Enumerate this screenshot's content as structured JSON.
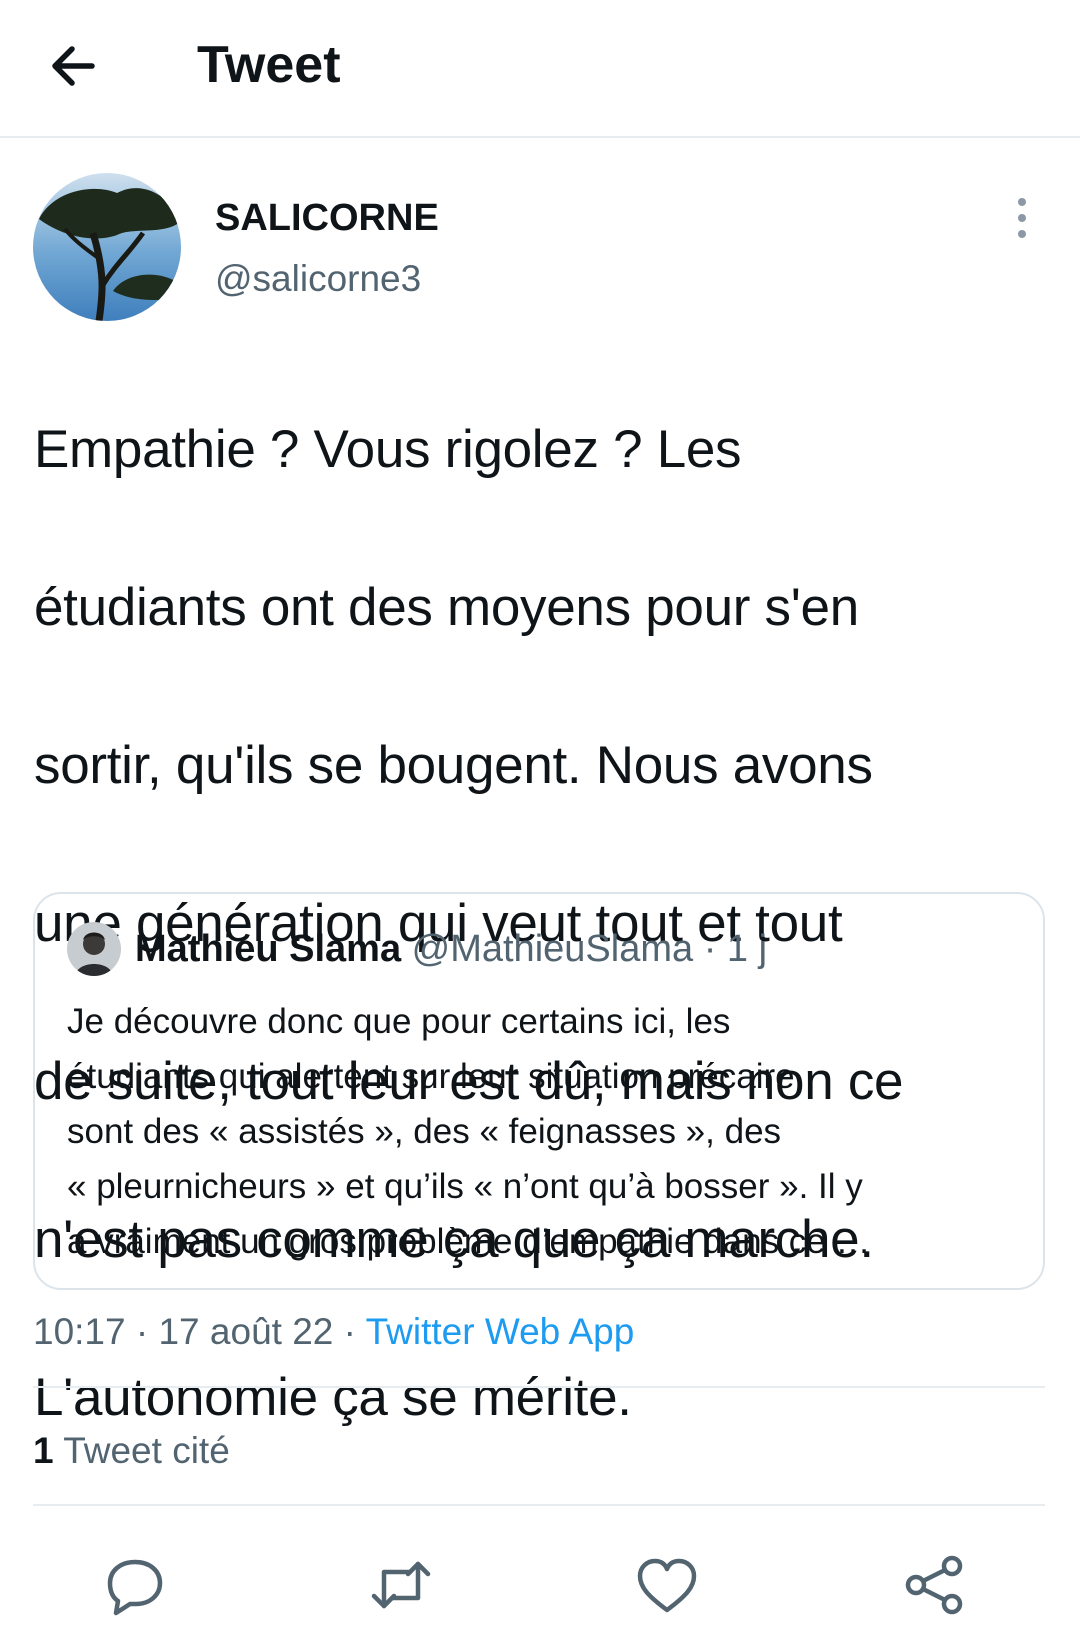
{
  "header": {
    "title": "Tweet",
    "back_icon": "arrow-left-icon"
  },
  "tweet": {
    "author": {
      "display_name": "SALICORNE",
      "handle": "@salicorne3"
    },
    "text_lines": [
      "Empathie ? Vous rigolez ? Les",
      "étudiants ont des moyens pour s'en",
      "sortir, qu'ils se bougent. Nous avons",
      "une génération qui veut tout et tout",
      "de suite, tout leur est dû, mais non ce",
      "n'est pas comme ça que ça marche.",
      "L'autonomie ça se mérite."
    ],
    "time": "10:17",
    "date": "17 août 22",
    "source": "Twitter Web App",
    "quote_count": "1",
    "quote_count_label": "Tweet cité"
  },
  "quoted_tweet": {
    "display_name": "Mathieu Slama",
    "handle": "@MathieuSlama",
    "age": "1 j",
    "text_lines": [
      "Je découvre donc que pour certains ici, les",
      "étudiants qui alertent sur leur situation précaire",
      "sont des « assistés », des « feignasses », des",
      "« pleurnicheurs » et qu’ils « n’ont qu’à bosser ». Il y",
      "a vraiment un gros problème d’empathie dans ce …"
    ]
  },
  "actions": [
    {
      "name": "reply",
      "icon": "reply-icon"
    },
    {
      "name": "retweet",
      "icon": "retweet-icon"
    },
    {
      "name": "like",
      "icon": "heart-icon"
    },
    {
      "name": "share",
      "icon": "share-icon"
    }
  ],
  "colors": {
    "accent": "#1d9bf0",
    "secondary_text": "#536471",
    "border": "#e6ecf0",
    "text": "#0f1419"
  }
}
